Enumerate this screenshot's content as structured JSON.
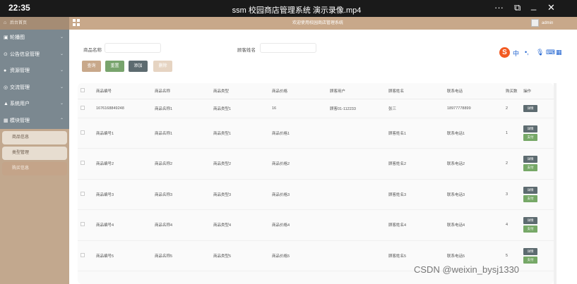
{
  "player": {
    "time": "22:35",
    "title": "ssm 校园商店管理系统 演示录像.mp4",
    "more": "···",
    "min": "_",
    "close": "✕",
    "window_icon": "⧉"
  },
  "topbar": {
    "home": "后台首页",
    "welcome": "欢迎使用校园商店管理系统",
    "user": "admin"
  },
  "sidebar": {
    "items": [
      {
        "icon": "▣",
        "label": "轮播图"
      },
      {
        "icon": "⊙",
        "label": "公告信息管理"
      },
      {
        "icon": "●",
        "label": "资源管理"
      },
      {
        "icon": "◎",
        "label": "交流管理"
      },
      {
        "icon": "▲",
        "label": "系统用户"
      },
      {
        "icon": "▦",
        "label": "模块管理"
      }
    ],
    "subitems": [
      {
        "label": "商品信息"
      },
      {
        "label": "类型管理"
      },
      {
        "label": "购买信息"
      }
    ]
  },
  "search": {
    "product_label": "商品名称",
    "product_value": "",
    "customer_label": "顾客姓名",
    "customer_value": "",
    "buttons": {
      "query": "查询",
      "reset": "重置",
      "add": "添加",
      "delete": "删除"
    }
  },
  "table": {
    "headers": [
      "商品编号",
      "商品名称",
      "商品类型",
      "商品价格",
      "顾客用户",
      "顾客姓名",
      "联系电话",
      "购买数",
      "操作"
    ],
    "rows": [
      [
        "1676168849248",
        "商品名称1",
        "商品类型1",
        "16",
        "顾客01-112233",
        "张三",
        "18977778899",
        "2"
      ],
      [
        "商品编号1",
        "商品名称1",
        "商品类型1",
        "商品价格1",
        "",
        "顾客姓名1",
        "联系电话1",
        "1"
      ],
      [
        "商品编号2",
        "商品名称2",
        "商品类型2",
        "商品价格2",
        "",
        "顾客姓名2",
        "联系电话2",
        "2"
      ],
      [
        "商品编号3",
        "商品名称3",
        "商品类型3",
        "商品价格3",
        "",
        "顾客姓名3",
        "联系电话3",
        "3"
      ],
      [
        "商品编号4",
        "商品名称4",
        "商品类型4",
        "商品价格4",
        "",
        "顾客姓名4",
        "联系电话4",
        "4"
      ],
      [
        "商品编号5",
        "商品名称5",
        "商品类型5",
        "商品价格5",
        "",
        "顾客姓名5",
        "联系电话5",
        "5"
      ]
    ],
    "detail_label": "详情",
    "pay_label": "支付"
  },
  "ime": {
    "lang": "中",
    "punct": "•,",
    "mic": "🎤",
    "kbd": "▦"
  },
  "watermark": "CSDN @weixin_bysj1330",
  "colors": {
    "sidebar_menu": "#7b8890",
    "sidebar_bg": "#c2a88e",
    "topbar": "#c8a88a",
    "detail": "#5d6b70",
    "pay": "#76a867"
  }
}
